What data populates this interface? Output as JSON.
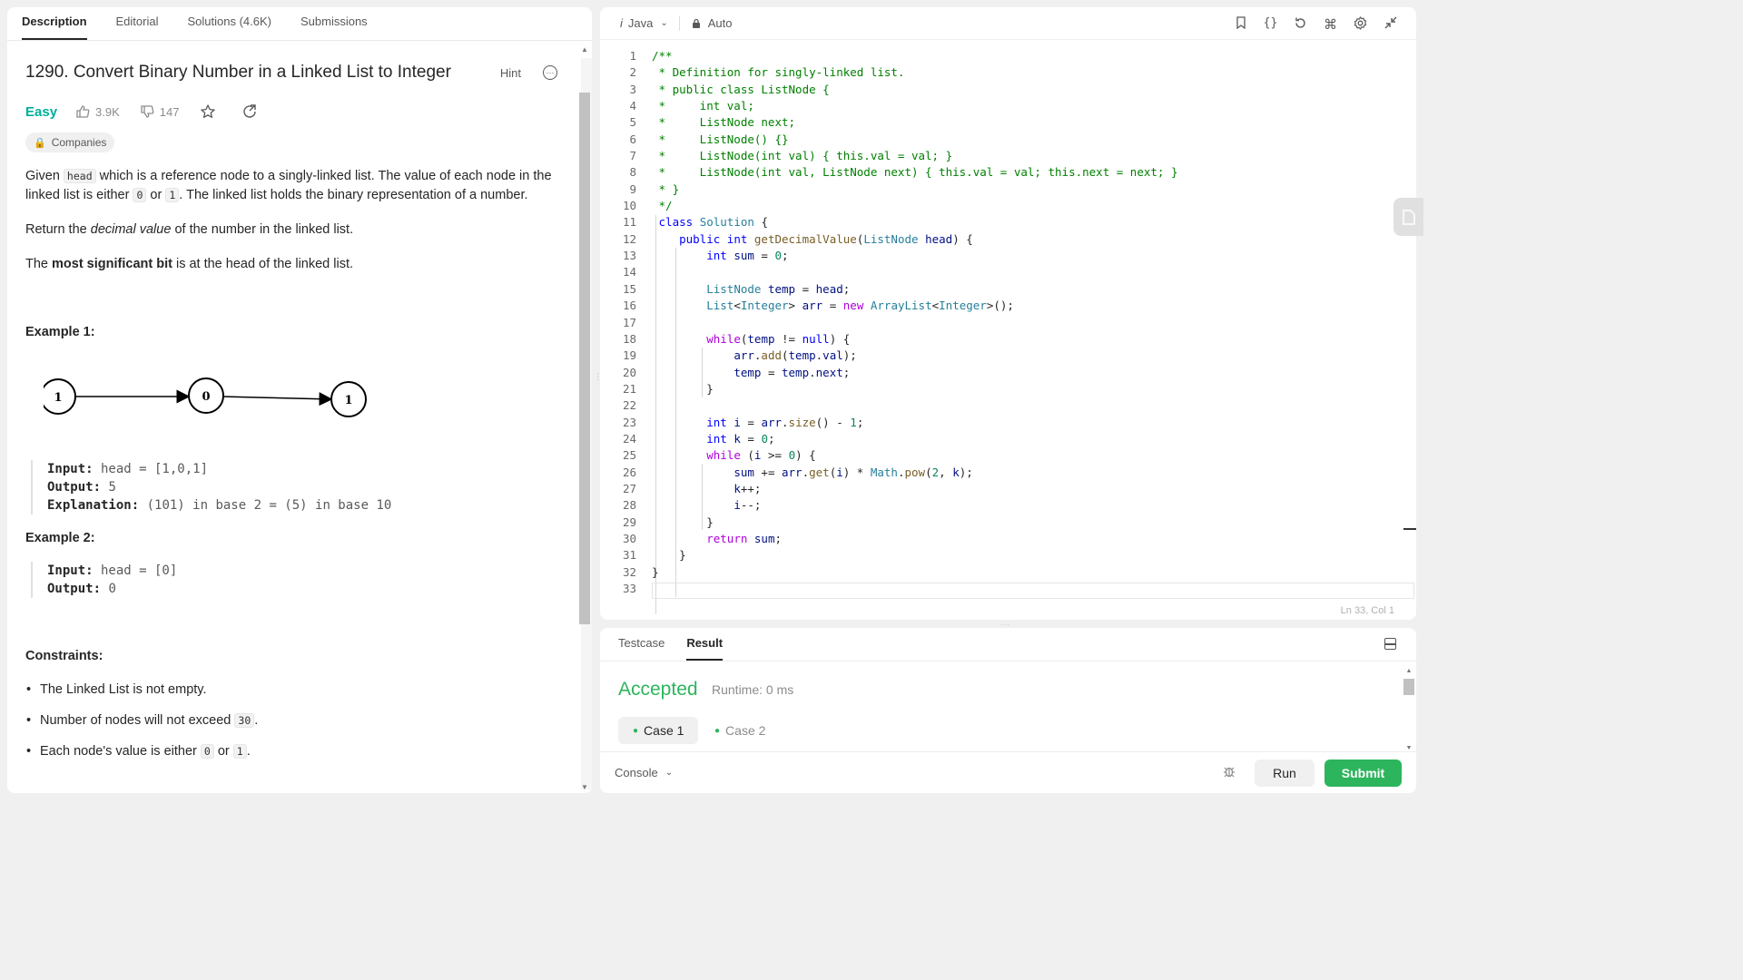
{
  "left_panel": {
    "tabs": [
      "Description",
      "Editorial",
      "Solutions (4.6K)",
      "Submissions"
    ],
    "title": "1290. Convert Binary Number in a Linked List to Integer",
    "hint": "Hint",
    "difficulty": "Easy",
    "likes": "3.9K",
    "dislikes": "147",
    "companies": "Companies",
    "desc_p1": [
      "Given ",
      "head",
      " which is a reference node to a singly-linked list. The value of each node in the linked list is either ",
      "0",
      " or ",
      "1",
      ". The linked list holds the binary representation of a number."
    ],
    "desc_p2": [
      "Return the ",
      "decimal value",
      " of the number in the linked list."
    ],
    "desc_p3": [
      "The ",
      "most significant bit",
      " is at the head of the linked list."
    ],
    "example1_title": "Example 1:",
    "example1_nodes": [
      "1",
      "0",
      "1"
    ],
    "example1_input_label": "Input:",
    "example1_input": " head = [1,0,1]",
    "example1_output_label": "Output:",
    "example1_output": " 5",
    "example1_expl_label": "Explanation:",
    "example1_expl": " (101) in base 2 = (5) in base 10",
    "example2_title": "Example 2:",
    "example2_input_label": "Input:",
    "example2_input": " head = [0]",
    "example2_output_label": "Output:",
    "example2_output": " 0",
    "constraints_title": "Constraints:",
    "constraint1": "The Linked List is not empty.",
    "constraint2": [
      "Number of nodes will not exceed ",
      "30",
      "."
    ],
    "constraint3": [
      "Each node's value is either ",
      "0",
      " or ",
      "1",
      "."
    ]
  },
  "editor": {
    "language": "Java",
    "mode": "Auto",
    "status": "Ln 33, Col 1",
    "line_numbers": [
      "1",
      "2",
      "3",
      "4",
      "5",
      "6",
      "7",
      "8",
      "9",
      "10",
      "11",
      "12",
      "13",
      "14",
      "15",
      "16",
      "17",
      "18",
      "19",
      "20",
      "21",
      "22",
      "23",
      "24",
      "25",
      "26",
      "27",
      "28",
      "29",
      "30",
      "31",
      "32",
      "33"
    ]
  },
  "result_panel": {
    "tabs": [
      "Testcase",
      "Result"
    ],
    "verdict": "Accepted",
    "runtime": "Runtime: 0 ms",
    "cases": [
      "Case 1",
      "Case 2"
    ],
    "console": "Console",
    "run": "Run",
    "submit": "Submit"
  },
  "colors": {
    "accent_green": "#2db55d",
    "easy": "#00af9b",
    "lock": "#ffa116"
  }
}
